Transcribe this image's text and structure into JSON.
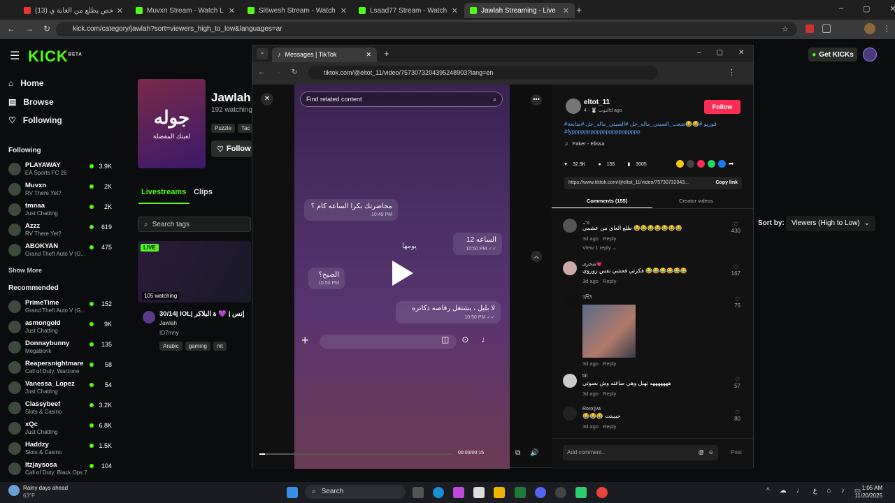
{
  "browser": {
    "tabs": [
      {
        "label": "(13) اخر شخص يطلع من الغابة ي",
        "active": false
      },
      {
        "label": "Muvxn Stream - Watch Live on",
        "active": false
      },
      {
        "label": "Sl6wesh Stream - Watch Live o",
        "active": false
      },
      {
        "label": "Lsaad77 Stream - Watch Live o",
        "active": false
      },
      {
        "label": "Jawlah Streaming - Live Stream",
        "active": true
      }
    ],
    "url": "kick.com/category/jawlah?sort=viewers_high_to_low&languages=ar"
  },
  "kick": {
    "logo": "KICK",
    "beta": "BETA",
    "get_kicks": "Get KICKs",
    "nav": {
      "home": "Home",
      "browse": "Browse",
      "following": "Following"
    },
    "following_title": "Following",
    "following": [
      {
        "name": "PLAYAWAY",
        "sub": "EA Sports FC 26",
        "count": "3.9K"
      },
      {
        "name": "Muvxn",
        "sub": "RV There Yet?",
        "count": "2K"
      },
      {
        "name": "tmnaa",
        "sub": "Just Chatting",
        "count": "2K"
      },
      {
        "name": "Azzz",
        "sub": "RV There Yet?",
        "count": "619"
      },
      {
        "name": "ABOKYAN",
        "sub": "Grand Theft Auto V (G...",
        "count": "475"
      }
    ],
    "show_more": "Show More",
    "recommended_title": "Recommended",
    "recommended": [
      {
        "name": "PrimeTime",
        "sub": "Grand Theft Auto V (G...",
        "count": "152"
      },
      {
        "name": "asmongold",
        "sub": "Just Chatting",
        "count": "9K"
      },
      {
        "name": "Donnaybunny",
        "sub": "Megabonk",
        "count": "135"
      },
      {
        "name": "Reapersnightmare",
        "sub": "Call of Duty: Warzone",
        "count": "58"
      },
      {
        "name": "Vanessa_Lopez",
        "sub": "Just Chatting",
        "count": "54"
      },
      {
        "name": "Classybeef",
        "sub": "Slots & Casino",
        "count": "3.2K"
      },
      {
        "name": "xQc",
        "sub": "Just Chatting",
        "count": "6.8K"
      },
      {
        "name": "Haddzy",
        "sub": "Slots & Casino",
        "count": "1.5K"
      },
      {
        "name": "Itzjaysosa",
        "sub": "Call of Duty: Black Ops 7",
        "count": "104"
      }
    ],
    "category": {
      "title": "Jawlah",
      "watching": "192 watching",
      "tags": [
        "Puzzle",
        "Tac"
      ],
      "follow": "Follow",
      "image_text": "جوله",
      "image_sub": "لعبتك المفضلة"
    },
    "tabs": {
      "livestreams": "Livestreams",
      "clips": "Clips"
    },
    "search_tags": "Search tags",
    "sort_label": "Sort by:",
    "sort_value": "Viewers (High to Low)",
    "stream": {
      "live": "LIVE",
      "watching": "105 watching",
      "title": "30/14| IOL| إنس | 💜 ة البلاكر",
      "channel": "Jawlah",
      "user": "ID7mny",
      "tags": [
        "Arabic",
        "gaming",
        "mt"
      ]
    }
  },
  "tiktok": {
    "tab_title": "Messages | TikTok",
    "url": "tiktok.com/@eltot_11/video/7573073204395248903?lang=en",
    "find_related": "Find related content",
    "messages": [
      {
        "text": "محاضرتك بكرا الساعه كام ؟",
        "time": "10:49 PM"
      },
      {
        "text": "الساعه 12",
        "time": "10:50 PM ✓✓"
      },
      {
        "text": "يومها",
        "time": ""
      },
      {
        "text": "الصبح؟",
        "time": "10:50 PM"
      },
      {
        "text": "لا بليل ، بشتغل رقاصه دكاتره",
        "time": "10:50 PM ✓✓"
      }
    ],
    "time_display": "00:00/00:15",
    "author": {
      "name": "eltot_11",
      "meta": "التوت 🐰 · 4d ago",
      "follow": "Follow"
    },
    "caption": "#قوريو #😂😂شعب_الصيني_ماله_حل #الصيني_ماله_حل #متابعة",
    "caption2": "#fypppppppppppppppppppppp",
    "music": "Faker - Elissa",
    "stats": {
      "likes": "32.9K",
      "comments": "155",
      "saves": "3005"
    },
    "share_url": "https://www.tiktok.com/@eltot_11/video/75730732043...",
    "copy_link": "Copy link",
    "tabs": {
      "comments": "Comments (155)",
      "creator": "Creator videos"
    },
    "comments": [
      {
        "user": "⋆˚࿔",
        "text": "طلع العاي من عشمي 😂😂😂😂😂😂😂",
        "date": "3d ago",
        "reply": "Reply",
        "likes": "430",
        "view_replies": "View 1 reply"
      },
      {
        "user": "شخرى💗",
        "text": "فكرتي فعشي نفس زوروي 😂😂😂😂😂😂",
        "date": "3d ago",
        "reply": "Reply",
        "likes": "167"
      },
      {
        "user": "ﾘ尺ﾘ",
        "text": "",
        "date": "3d ago",
        "reply": "Reply",
        "likes": "75"
      },
      {
        "user": "tiri",
        "text": "هههههههه تهبل وهي صاغته وش بصوتي",
        "date": "3d ago",
        "reply": "Reply",
        "likes": "57"
      },
      {
        "user": "Roro;jva",
        "text": "😂😂😂 حبيبتت",
        "date": "3d ago",
        "reply": "Reply",
        "likes": "80"
      }
    ],
    "add_comment": "Add comment...",
    "post": "Post"
  },
  "taskbar": {
    "weather_title": "Rainy days ahead",
    "weather_temp": "63°F",
    "search": "Search",
    "time": "1:05 AM",
    "date": "11/20/2025",
    "lang": "ع"
  }
}
